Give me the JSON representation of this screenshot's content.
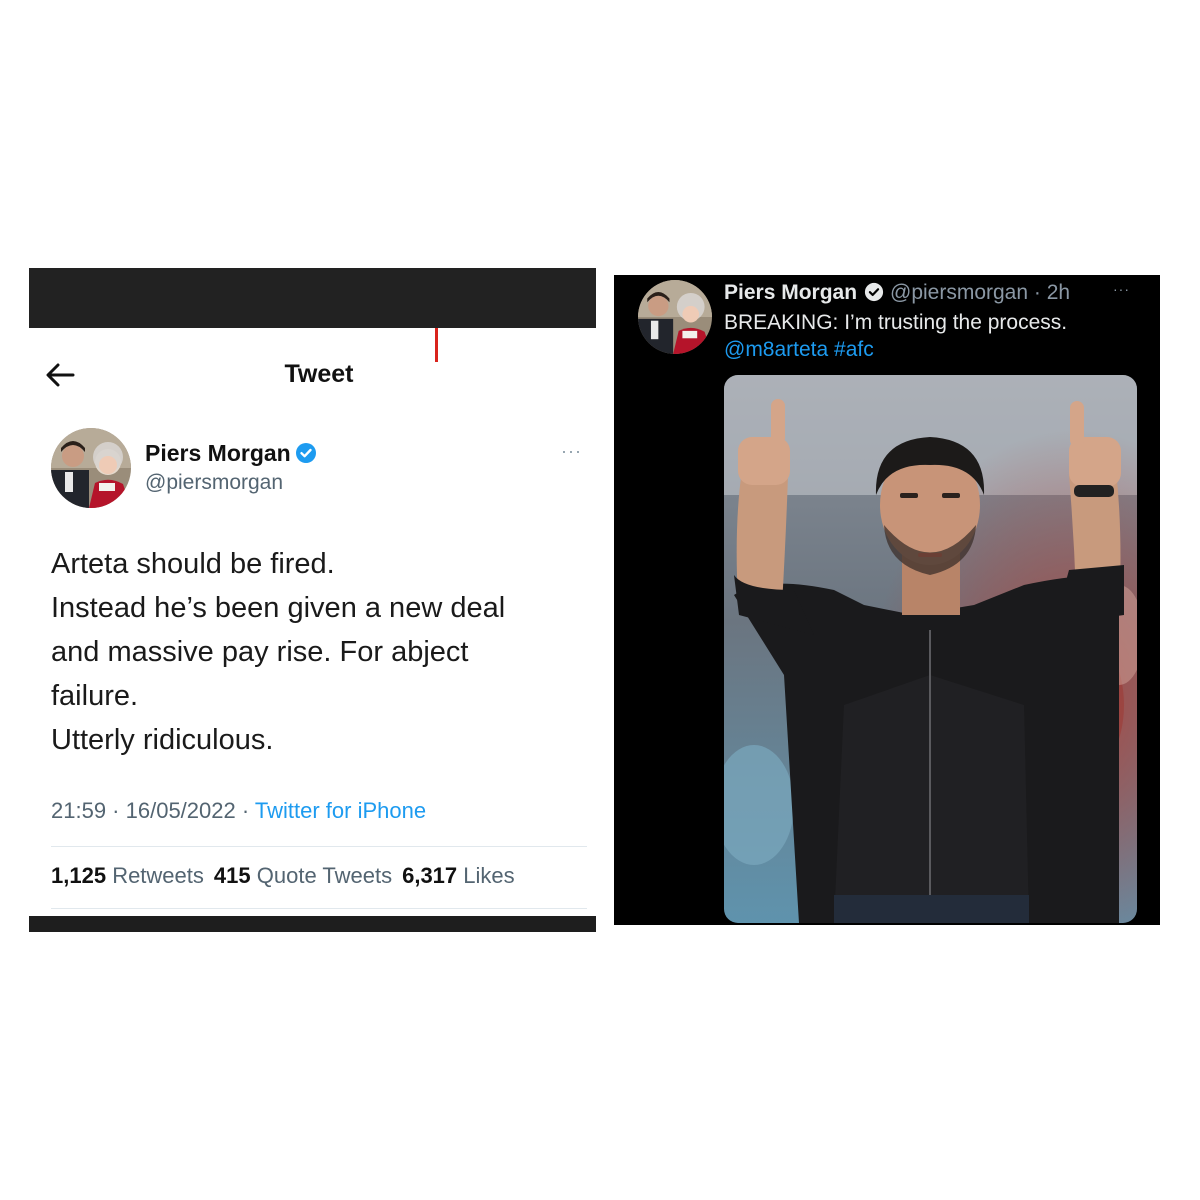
{
  "left_tweet": {
    "header_title": "Tweet",
    "author": {
      "name": "Piers Morgan",
      "handle": "@piersmorgan",
      "verified": true
    },
    "more_label": "···",
    "text_lines": [
      "Arteta should be fired.",
      "Instead he’s been given a new deal",
      "and massive pay rise. For abject",
      "failure.",
      "Utterly ridiculous."
    ],
    "time": "21:59",
    "date": "16/05/2022",
    "source": "Twitter for iPhone",
    "separator": " · ",
    "stats": {
      "retweets_count": "1,125",
      "retweets_label": "Retweets",
      "quotes_count": "415",
      "quotes_label": "Quote Tweets",
      "likes_count": "6,317",
      "likes_label": "Likes"
    }
  },
  "right_tweet": {
    "author": {
      "name": "Piers Morgan",
      "handle_time": "@piersmorgan · 2h",
      "verified": true
    },
    "more_label": "···",
    "text": "BREAKING: I’m trusting the process.",
    "links": "@m8arteta #afc"
  },
  "colors": {
    "accent_blue": "#1d9bf0",
    "light_secondary_text": "#536471",
    "dark_background": "#000000",
    "dark_primary_text": "#e7e9ea"
  }
}
